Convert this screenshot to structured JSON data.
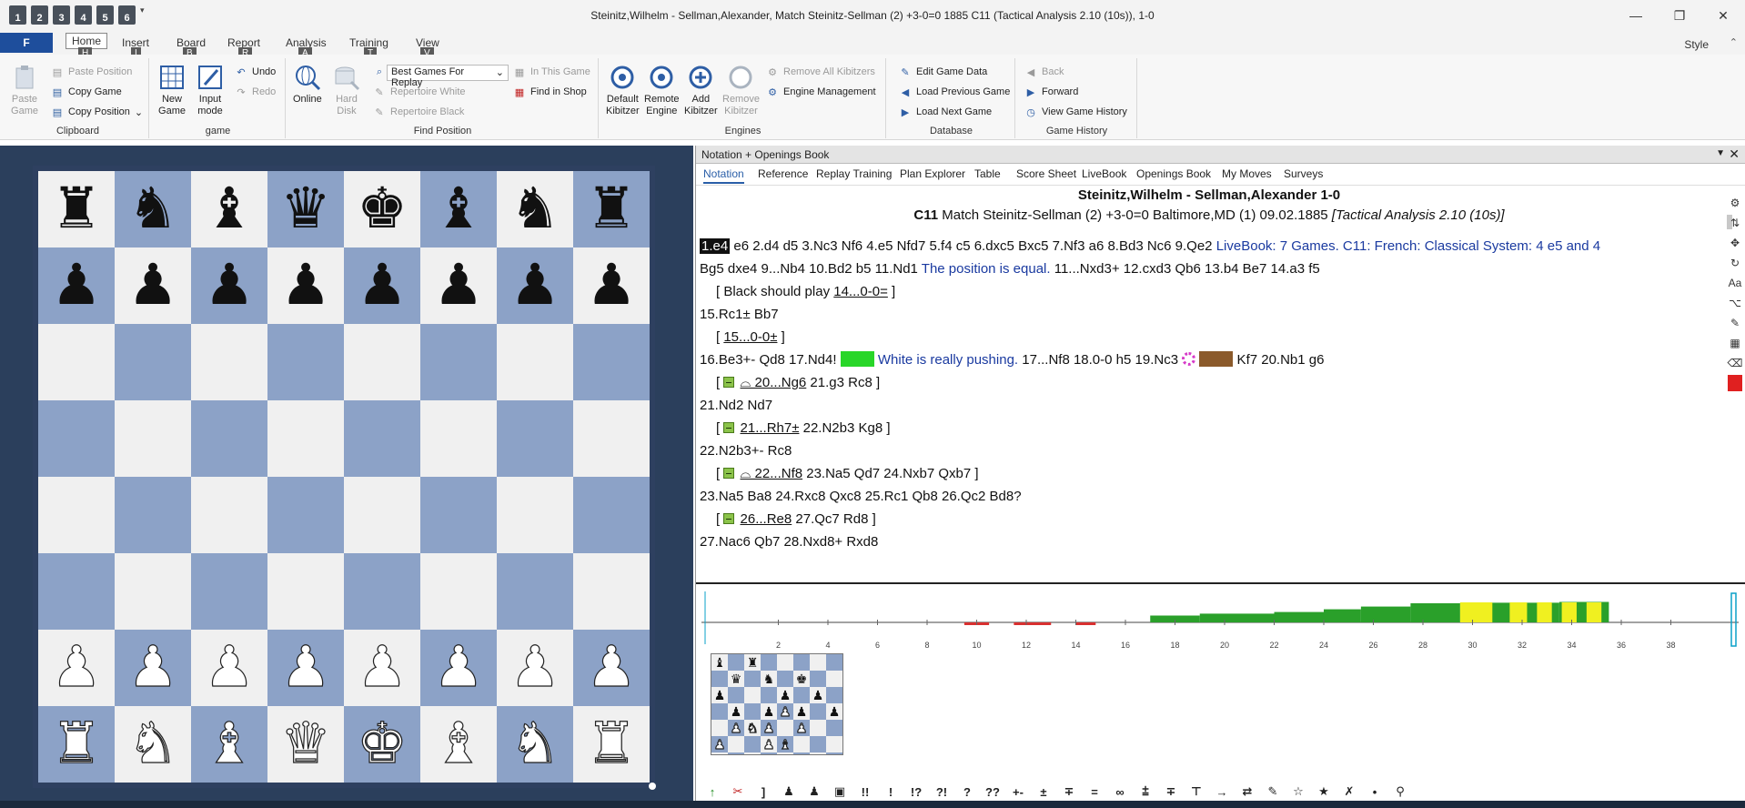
{
  "window": {
    "title": "Steinitz,Wilhelm - Sellman,Alexander, Match Steinitz-Sellman (2) +3-0=0 1885  C11  (Tactical Analysis 2.10 (10s)), 1-0",
    "qat_buttons": [
      "1",
      "2",
      "3",
      "4",
      "5",
      "6"
    ],
    "controls": {
      "minimize": "—",
      "restore": "❐",
      "close": "✕"
    }
  },
  "ribbon_tabs": {
    "file": "F",
    "tabs": [
      {
        "label": "Home",
        "key": "H"
      },
      {
        "label": "Insert",
        "key": "I"
      },
      {
        "label": "Board",
        "key": "B"
      },
      {
        "label": "Report",
        "key": "R"
      },
      {
        "label": "Analysis",
        "key": "A"
      },
      {
        "label": "Training",
        "key": "T"
      },
      {
        "label": "View",
        "key": "V"
      }
    ],
    "style": "Style",
    "collapse": "⌃"
  },
  "ribbon": {
    "clipboard": {
      "label": "Clipboard",
      "paste_game": "Paste\nGame",
      "paste_position": "Paste Position",
      "copy_game": "Copy Game",
      "copy_position": "Copy Position"
    },
    "game": {
      "label": "game",
      "new_game": "New\nGame",
      "input_mode": "Input\nmode",
      "undo": "Undo",
      "redo": "Redo"
    },
    "find_position": {
      "label": "Find Position",
      "online": "Online",
      "hard_disk": "Hard\nDisk",
      "best_games": "Best Games For Replay",
      "repertoire_white": "Repertoire White",
      "repertoire_black": "Repertoire Black",
      "in_this_game": "In This Game",
      "find_in_shop": "Find in Shop"
    },
    "engines": {
      "label": "Engines",
      "default_kibitzer": "Default\nKibitzer",
      "remote_engine": "Remote\nEngine",
      "add_kibitzer": "Add\nKibitzer",
      "remove_kibitzer": "Remove\nKibitzer",
      "remove_all_kibitzers": "Remove All Kibitzers",
      "engine_management": "Engine Management"
    },
    "database": {
      "label": "Database",
      "edit_game_data": "Edit Game Data",
      "load_previous_game": "Load Previous Game",
      "load_next_game": "Load Next Game"
    },
    "game_history": {
      "label": "Game History",
      "back": "Back",
      "forward": "Forward",
      "view_game_history": "View Game History"
    }
  },
  "board": {
    "ranks": [
      [
        "r",
        "n",
        "b",
        "q",
        "k",
        "b",
        "n",
        "r"
      ],
      [
        "p",
        "p",
        "p",
        "p",
        "p",
        "p",
        "p",
        "p"
      ],
      [
        "",
        "",
        "",
        "",
        "",
        "",
        "",
        ""
      ],
      [
        "",
        "",
        "",
        "",
        "",
        "",
        "",
        ""
      ],
      [
        "",
        "",
        "",
        "",
        "",
        "",
        "",
        ""
      ],
      [
        "",
        "",
        "",
        "",
        "",
        "",
        "",
        ""
      ],
      [
        "P",
        "P",
        "P",
        "P",
        "P",
        "P",
        "P",
        "P"
      ],
      [
        "R",
        "N",
        "B",
        "Q",
        "K",
        "B",
        "N",
        "R"
      ]
    ]
  },
  "notation_panel": {
    "title": "Notation + Openings Book",
    "subtabs": [
      "Notation",
      "Reference",
      "Replay Training",
      "Plan Explorer",
      "Table",
      "Score Sheet",
      "LiveBook",
      "Openings Book",
      "My Moves",
      "Surveys"
    ],
    "players": "Steinitz,Wilhelm - Sellman,Alexander  1-0",
    "eco": "C11",
    "event": "Match Steinitz-Sellman (2) +3-0=0 Baltimore,MD (1) 09.02.1885",
    "annotator": "[Tactical Analysis 2.10 (10s)]"
  },
  "notation": {
    "l1_hl": "1.e4",
    "l1_moves": " e6  2.d4  d5  3.Nc3  Nf6  4.e5  Nfd7  5.f4  c5  6.dxc5  Bxc5  7.Nf3  a6  8.Bd3  Nc6  9.Qe2 ",
    "l1_livebook": "LiveBook: 7 Games. C11: French: Classical System: 4 e5 and 4",
    "l2_moves": "Bg5 dxe4  9...Nb4  10.Bd2  b5  11.Nd1 ",
    "l2_comment": "The position is equal.",
    "l2_moves2": "  11...Nxd3+  12.cxd3  Qb6  13.b4  Be7  14.a3  f5",
    "l3_text": "[ Black should play ",
    "l3_link": "14...0-0=",
    "l3_close": " ]",
    "l4": "15.Rc1±  Bb7",
    "l5_open": "[ ",
    "l5_link": "15...0-0±",
    "l5_close": " ]",
    "l6_moves": "16.Be3+-  Qd8  17.Nd4! ",
    "l6_comment": " White is really pushing.",
    "l6_moves2": "  17...Nf8  18.0-0  h5  19.Nc3 ",
    "l6_moves3": "  Kf7  20.Nb1  g6",
    "l7_link": "⌓ 20...Ng6",
    "l7_rest": "  21.g3  Rc8 ]",
    "l8": "21.Nd2  Nd7",
    "l9_link": "21...Rh7±",
    "l9_rest": "  22.N2b3  Kg8 ]",
    "l10": "22.N2b3+-  Rc8",
    "l11_link": "⌓ 22...Nf8",
    "l11_rest": "  23.Na5  Qd7  24.Nxb7  Qxb7 ]",
    "l12": "23.Na5  Ba8  24.Rxc8  Qxc8  25.Rc1  Qb8  26.Qc2  Bd8?",
    "l13_link": "26...Re8",
    "l13_rest": "  27.Qc7  Rd8 ]",
    "l14": "27.Nac6  Qb7  28.Nxd8+  Rxd8",
    "bracket_open": "[ "
  },
  "mini_board": {
    "ranks": [
      [
        "b",
        "",
        "r",
        "",
        "",
        "",
        "",
        ""
      ],
      [
        "",
        "q",
        "",
        "n",
        "",
        "k",
        "",
        ""
      ],
      [
        "p",
        "",
        "",
        "",
        "p",
        "",
        "p",
        ""
      ],
      [
        "",
        "p",
        "",
        "p",
        "P",
        "p",
        "",
        "p"
      ],
      [
        "",
        "P",
        "N",
        "P",
        "",
        "P",
        "",
        ""
      ],
      [
        "P",
        "",
        "",
        "P",
        "B",
        "",
        "",
        ""
      ],
      [
        "",
        "",
        "",
        "",
        "",
        "",
        "",
        ""
      ],
      [
        "",
        "",
        "",
        "",
        "",
        "",
        "",
        ""
      ]
    ]
  },
  "eval_graph": {
    "x_ticks": [
      "2",
      "4",
      "6",
      "8",
      "10",
      "12",
      "14",
      "16",
      "18",
      "20",
      "22",
      "24",
      "26",
      "28",
      "30",
      "32",
      "34",
      "36",
      "38"
    ],
    "bars": [
      {
        "from": 17.0,
        "to": 19.0,
        "v": 0.25
      },
      {
        "from": 19.0,
        "to": 22.0,
        "v": 0.32
      },
      {
        "from": 22.0,
        "to": 24.0,
        "v": 0.38
      },
      {
        "from": 24.0,
        "to": 25.5,
        "v": 0.48
      },
      {
        "from": 25.5,
        "to": 27.5,
        "v": 0.58
      },
      {
        "from": 27.5,
        "to": 29.5,
        "v": 0.7
      },
      {
        "from": 29.5,
        "to": 30.5,
        "v": 0.72
      },
      {
        "from": 30.5,
        "to": 33.5,
        "v": 0.72
      },
      {
        "from": 33.5,
        "to": 35.5,
        "v": 0.75
      }
    ],
    "yellow_segments": [
      [
        29.5,
        30.8
      ],
      [
        31.5,
        32.2
      ],
      [
        32.6,
        33.2
      ],
      [
        33.6,
        34.2
      ],
      [
        34.6,
        35.2
      ]
    ],
    "negatives": [
      [
        9.5,
        10.5
      ],
      [
        11.5,
        13
      ],
      [
        14,
        14.8
      ]
    ],
    "colors": {
      "positive": "#2aa02a",
      "highlight": "#f0f020",
      "negative": "#d83030",
      "cursor": "#0aa0c8"
    }
  },
  "bottom_toolbar": [
    "↑",
    "✂",
    "]",
    "♟",
    "♟",
    "▣",
    "!!",
    "!",
    "!?",
    "?!",
    "?",
    "??",
    "+-",
    "±",
    "∓",
    "=",
    "∞",
    "⩲",
    "∓",
    "⊤",
    "→",
    "⇄",
    "✎",
    "☆",
    "★",
    "✗",
    "•",
    "⚲"
  ]
}
